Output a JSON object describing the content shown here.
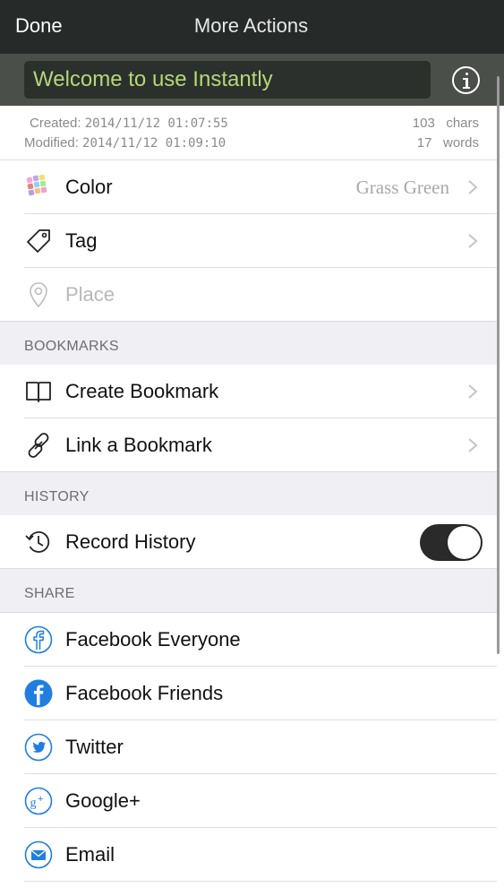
{
  "nav": {
    "done_label": "Done",
    "title": "More Actions"
  },
  "note": {
    "title": "Welcome to use Instantly",
    "created_label": "Created:",
    "created_value": "2014/11/12 01:07:55",
    "modified_label": "Modified:",
    "modified_value": "2014/11/12 01:09:10",
    "chars_count": "103",
    "chars_label": "chars",
    "words_count": "17",
    "words_label": "words"
  },
  "properties": [
    {
      "label": "Color",
      "value": "Grass Green",
      "icon": "color-palette-icon"
    },
    {
      "label": "Tag",
      "icon": "tag-icon"
    },
    {
      "label": "Place",
      "icon": "location-pin-icon",
      "disabled": true
    }
  ],
  "bookmarks": {
    "header": "BOOKMARKS",
    "items": [
      {
        "label": "Create Bookmark",
        "icon": "book-icon"
      },
      {
        "label": "Link a Bookmark",
        "icon": "link-icon"
      }
    ]
  },
  "history": {
    "header": "HISTORY",
    "items": [
      {
        "label": "Record History",
        "icon": "history-clock-icon",
        "toggle_on": true
      }
    ]
  },
  "share": {
    "header": "SHARE",
    "items": [
      {
        "label": "Facebook Everyone",
        "icon": "facebook-outline-icon"
      },
      {
        "label": "Facebook Friends",
        "icon": "facebook-filled-icon"
      },
      {
        "label": "Twitter",
        "icon": "twitter-icon"
      },
      {
        "label": "Google+",
        "icon": "google-plus-icon"
      },
      {
        "label": "Email",
        "icon": "email-icon"
      }
    ]
  },
  "colors": {
    "navbar": "#262a29",
    "title_bar": "#4a5049",
    "title_text": "#b5d779",
    "accent_blue": "#1f7ee0",
    "toggle_on": "#2a2a2a"
  }
}
